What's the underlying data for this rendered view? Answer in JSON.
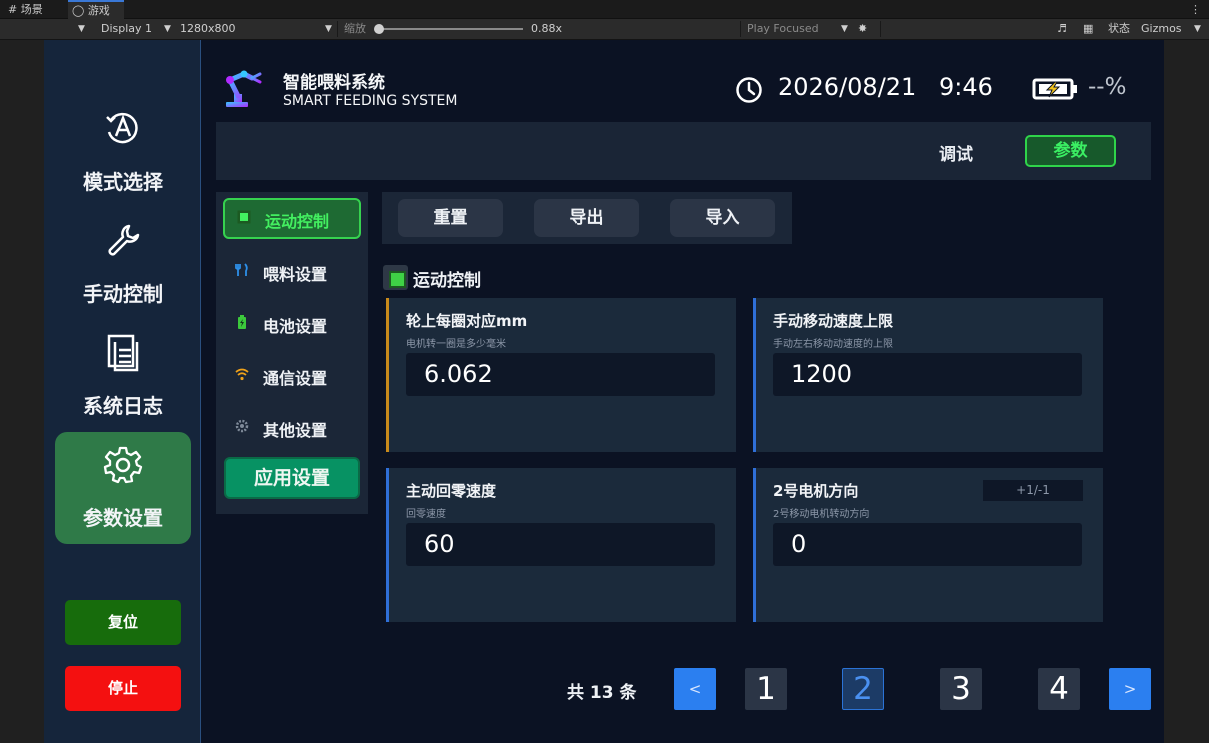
{
  "editor": {
    "tabs": [
      {
        "label": "场景",
        "icon": "grid-icon"
      },
      {
        "label": "游戏",
        "icon": "gamepad-icon"
      }
    ],
    "toolbar": {
      "display": "Display 1",
      "resolution": "1280x800",
      "scale_label": "缩放",
      "scale_value": "0.88x",
      "play_mode": "Play Focused",
      "state_label": "状态",
      "gizmos": "Gizmos"
    }
  },
  "sidebar": {
    "items": [
      {
        "label": "模式选择",
        "icon": "mode-a-icon"
      },
      {
        "label": "手动控制",
        "icon": "wrench-icon"
      },
      {
        "label": "系统日志",
        "icon": "document-icon"
      },
      {
        "label": "参数设置",
        "icon": "gear-icon",
        "active": true
      }
    ],
    "reset_label": "复位",
    "stop_label": "停止"
  },
  "header": {
    "title_cn": "智能喂料系统",
    "title_en": "SMART FEEDING SYSTEM",
    "date": "2026/08/21",
    "time": "9:46",
    "battery_pct": "--%"
  },
  "tabs": {
    "debug": "调试",
    "params": "参数"
  },
  "settings_menu": {
    "items": [
      {
        "label": "运动控制",
        "icon": "chip-icon",
        "active": true
      },
      {
        "label": "喂料设置",
        "icon": "utensils-icon"
      },
      {
        "label": "电池设置",
        "icon": "battery-icon"
      },
      {
        "label": "通信设置",
        "icon": "wifi-icon"
      },
      {
        "label": "其他设置",
        "icon": "gear-icon"
      }
    ],
    "apply_label": "应用设置"
  },
  "actions": {
    "reset": "重置",
    "export": "导出",
    "import": "导入"
  },
  "section": {
    "title": "运动控制"
  },
  "params": [
    {
      "title": "轮上每圈对应mm",
      "desc": "电机转一圈是多少毫米",
      "value": "6.062",
      "accent": "#c98a1b"
    },
    {
      "title": "手动移动速度上限",
      "desc": "手动左右移动动速度的上限",
      "value": "1200",
      "accent": "#2f6fd8"
    },
    {
      "title": "主动回零速度",
      "desc": "回零速度",
      "value": "60",
      "accent": "#2f6fd8"
    },
    {
      "title": "2号电机方向",
      "desc": "2号移动电机转动方向",
      "value": "0",
      "range": "+1/-1",
      "accent": "#2f6fd8"
    }
  ],
  "pagination": {
    "total": "共 13 条",
    "prev": "<",
    "next": ">",
    "pages": [
      "1",
      "2",
      "3",
      "4"
    ],
    "current": "2"
  },
  "colors": {
    "active_green": "#2f7a48",
    "accent_blue": "#2b7ff0",
    "stop_red": "#f41010",
    "reset_green": "#176c0c"
  }
}
